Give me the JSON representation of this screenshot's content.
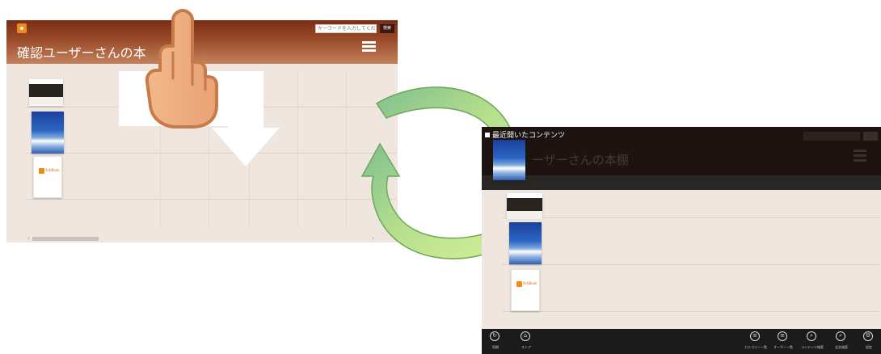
{
  "screen_a": {
    "title": "確認ユーザーさんの本",
    "search_placeholder": "キーワードを入力してください",
    "search_button": "検索",
    "scroll_left": "‹",
    "scroll_right": "›"
  },
  "screen_b": {
    "recent_label": "最近開いたコンテンツ",
    "ghost_title": "ーザーさんの本棚",
    "appbar": {
      "left": [
        {
          "label": "同期",
          "icon": "sync-icon"
        },
        {
          "label": "ストア",
          "icon": "store-icon"
        }
      ],
      "right": [
        {
          "label": "カテゴリー一覧",
          "icon": "category-list-icon"
        },
        {
          "label": "オーサー一覧",
          "icon": "author-list-icon"
        },
        {
          "label": "コンテンツ検索",
          "icon": "content-search-icon"
        },
        {
          "label": "全文検索",
          "icon": "fulltext-search-icon"
        },
        {
          "label": "設定",
          "icon": "settings-icon"
        }
      ]
    }
  },
  "colors": {
    "header_brown": "#7a2d12",
    "shelf_bg": "#efe7df",
    "arrow_green": "#9fd37a",
    "appbar": "#1b1b1b"
  }
}
